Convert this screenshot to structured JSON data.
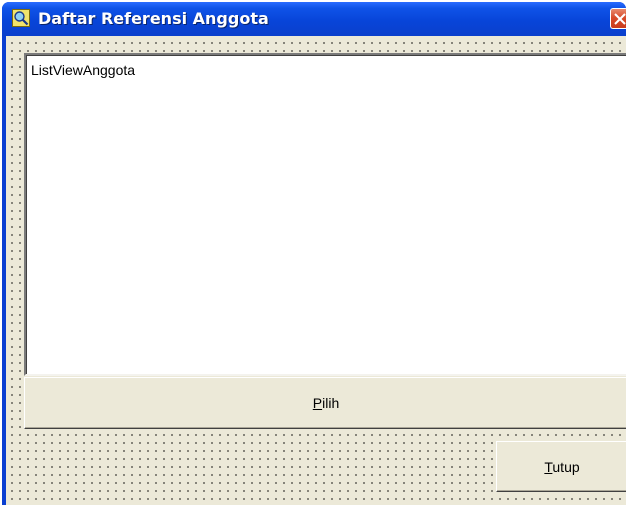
{
  "window": {
    "title": "Daftar Referensi Anggota",
    "title_icon": "search-app-icon",
    "close_icon": "close-icon"
  },
  "listview": {
    "caption": "ListViewAnggota"
  },
  "buttons": {
    "pilih": {
      "accel": "P",
      "rest": "ilih"
    },
    "tutup": {
      "accel": "T",
      "rest": "utup"
    }
  },
  "colors": {
    "titlebar": "#0845d9",
    "client": "#ece9d8",
    "close": "#d84b2a"
  }
}
